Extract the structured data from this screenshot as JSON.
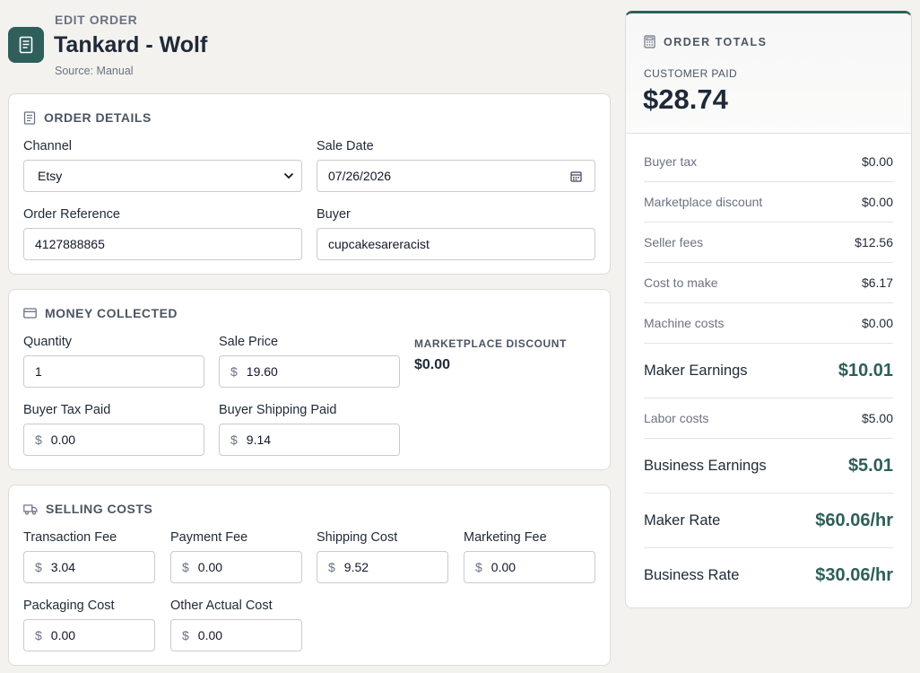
{
  "header": {
    "eyebrow": "EDIT ORDER",
    "title": "Tankard - Wolf",
    "source": "Source: Manual",
    "icon": "document-icon"
  },
  "order_details": {
    "title": "ORDER DETAILS",
    "channel": {
      "label": "Channel",
      "value": "Etsy"
    },
    "sale_date": {
      "label": "Sale Date",
      "value": "07/26/2026"
    },
    "order_reference": {
      "label": "Order Reference",
      "value": "4127888865"
    },
    "buyer": {
      "label": "Buyer",
      "value": "cupcakesareracist"
    }
  },
  "money_collected": {
    "title": "MONEY COLLECTED",
    "quantity": {
      "label": "Quantity",
      "value": "1"
    },
    "sale_price": {
      "label": "Sale Price",
      "prefix": "$",
      "value": "19.60"
    },
    "marketplace_discount": {
      "label": "MARKETPLACE DISCOUNT",
      "value": "$0.00"
    },
    "buyer_tax_paid": {
      "label": "Buyer Tax Paid",
      "prefix": "$",
      "value": "0.00"
    },
    "buyer_shipping_paid": {
      "label": "Buyer Shipping Paid",
      "prefix": "$",
      "value": "9.14"
    }
  },
  "selling_costs": {
    "title": "SELLING COSTS",
    "transaction_fee": {
      "label": "Transaction Fee",
      "prefix": "$",
      "value": "3.04"
    },
    "payment_fee": {
      "label": "Payment Fee",
      "prefix": "$",
      "value": "0.00"
    },
    "shipping_cost": {
      "label": "Shipping Cost",
      "prefix": "$",
      "value": "9.52"
    },
    "marketing_fee": {
      "label": "Marketing Fee",
      "prefix": "$",
      "value": "0.00"
    },
    "packaging_cost": {
      "label": "Packaging Cost",
      "prefix": "$",
      "value": "0.00"
    },
    "other_actual_cost": {
      "label": "Other Actual Cost",
      "prefix": "$",
      "value": "0.00"
    }
  },
  "totals": {
    "title": "ORDER TOTALS",
    "customer_paid_label": "CUSTOMER PAID",
    "customer_paid_value": "$28.74",
    "rows": [
      {
        "label": "Buyer tax",
        "value": "$0.00",
        "kind": "small"
      },
      {
        "label": "Marketplace discount",
        "value": "$0.00",
        "kind": "small"
      },
      {
        "label": "Seller fees",
        "value": "$12.56",
        "kind": "small"
      },
      {
        "label": "Cost to make",
        "value": "$6.17",
        "kind": "small"
      },
      {
        "label": "Machine costs",
        "value": "$0.00",
        "kind": "small"
      },
      {
        "label": "Maker Earnings",
        "value": "$10.01",
        "kind": "big"
      },
      {
        "label": "Labor costs",
        "value": "$5.00",
        "kind": "small"
      },
      {
        "label": "Business Earnings",
        "value": "$5.01",
        "kind": "big"
      },
      {
        "label": "Maker Rate",
        "value": "$60.06/hr",
        "kind": "big"
      },
      {
        "label": "Business Rate",
        "value": "$30.06/hr",
        "kind": "big"
      }
    ]
  },
  "colors": {
    "accent": "#2e5f5a",
    "background": "#f3f2ef"
  }
}
